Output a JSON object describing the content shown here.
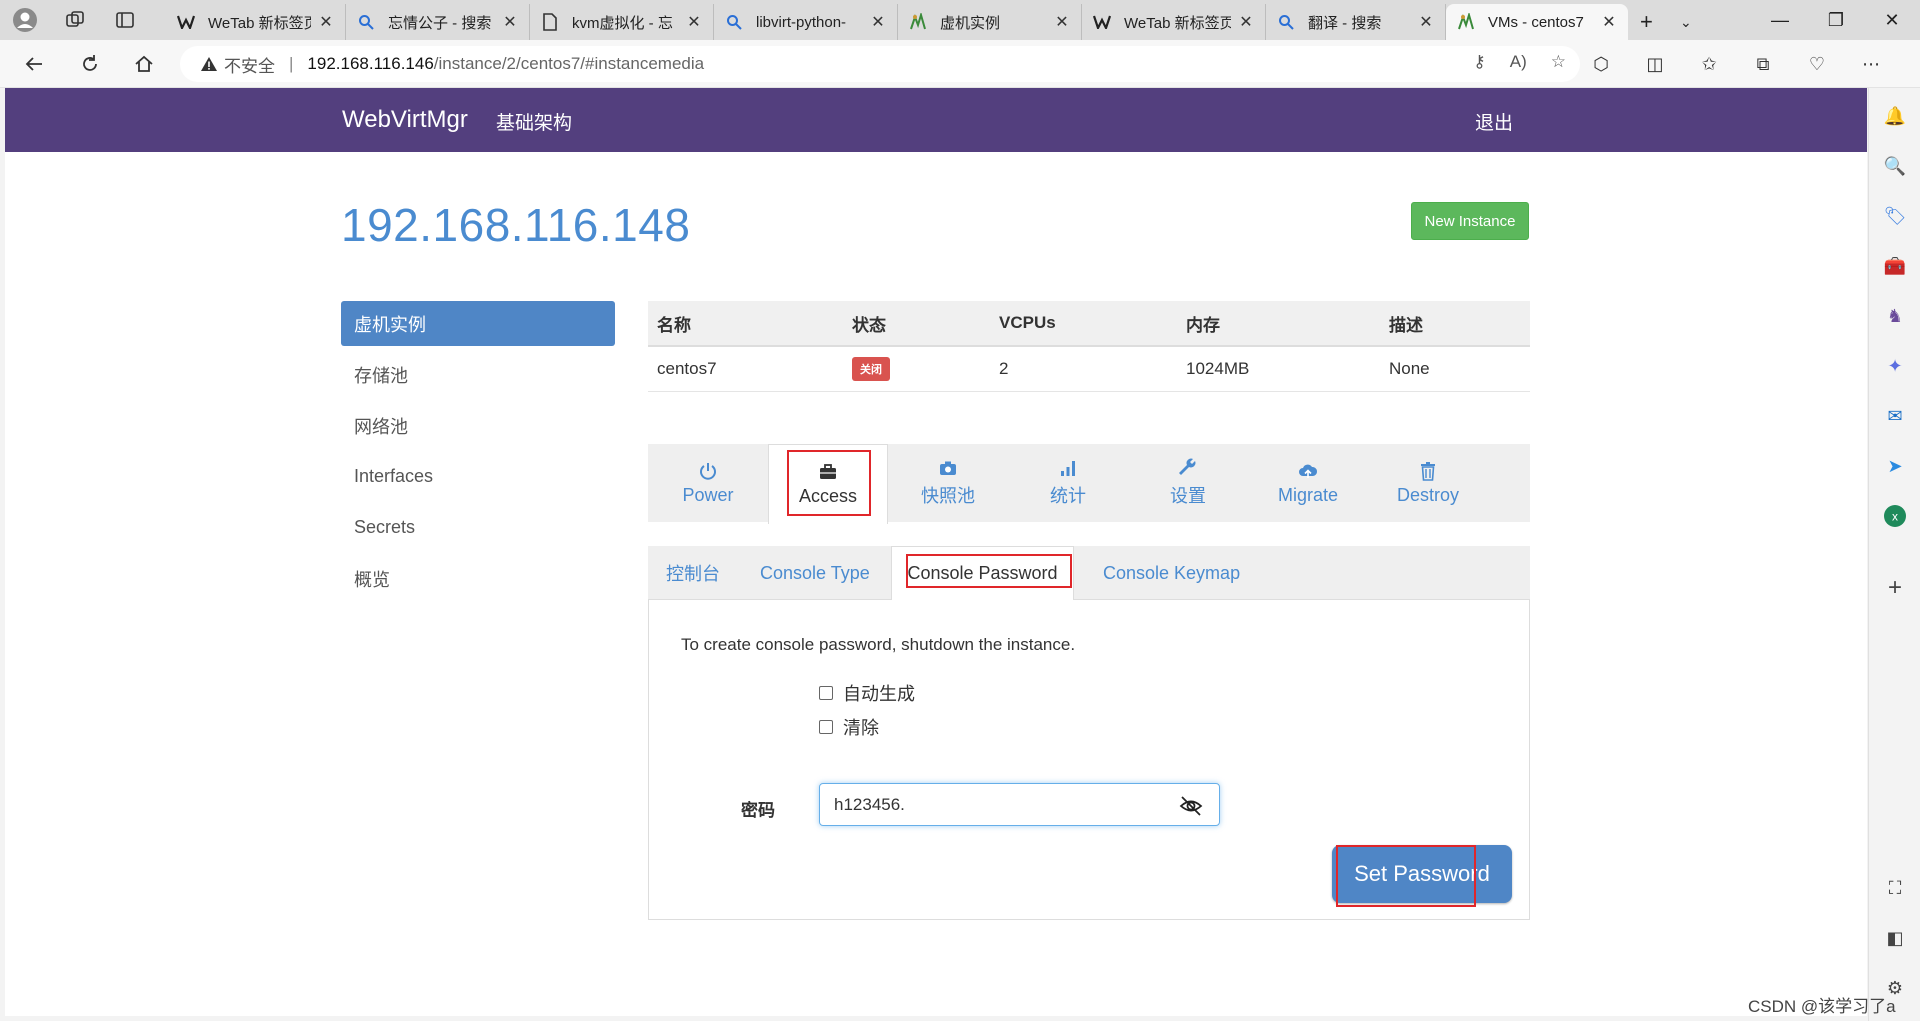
{
  "browser": {
    "tabs": [
      {
        "title": "WeTab 新标签页",
        "icon": "wetab-icon"
      },
      {
        "title": "忘情公子 - 搜索",
        "icon": "search-icon"
      },
      {
        "title": "kvm虚拟化 - 忘",
        "icon": "document-icon"
      },
      {
        "title": "libvirt-python-",
        "icon": "search-icon"
      },
      {
        "title": "虚机实例",
        "icon": "webvirtmgr-icon"
      },
      {
        "title": "WeTab 新标签页",
        "icon": "wetab-icon"
      },
      {
        "title": "翻译 - 搜索",
        "icon": "search-icon"
      },
      {
        "title": "VMs - centos7",
        "icon": "webvirtmgr-icon",
        "active": true
      }
    ],
    "address": {
      "warning": "不安全",
      "separator": "|",
      "host": "192.168.116.146",
      "path": "/instance/2/centos7/#instancemedia"
    }
  },
  "navbar": {
    "brand": "WebVirtMgr",
    "link": "基础架构",
    "logout": "退出"
  },
  "header": {
    "title": "192.168.116.148",
    "new_instance": "New Instance"
  },
  "sidebar": {
    "items": [
      {
        "label": "虚机实例",
        "active": true
      },
      {
        "label": "存储池"
      },
      {
        "label": "网络池"
      },
      {
        "label": "Interfaces"
      },
      {
        "label": "Secrets"
      },
      {
        "label": "概览"
      }
    ]
  },
  "vm_table": {
    "headers": [
      "名称",
      "状态",
      "VCPUs",
      "内存",
      "描述"
    ],
    "row": {
      "name": "centos7",
      "status": "关闭",
      "vcpus": "2",
      "memory": "1024MB",
      "description": "None"
    }
  },
  "action_tabs": [
    {
      "label": "Power",
      "icon": "power-icon"
    },
    {
      "label": "Access",
      "icon": "briefcase-icon",
      "active": true
    },
    {
      "label": "快照池",
      "icon": "camera-icon"
    },
    {
      "label": "统计",
      "icon": "signal-bars-icon"
    },
    {
      "label": "设置",
      "icon": "wrench-icon"
    },
    {
      "label": "Migrate",
      "icon": "cloud-upload-icon"
    },
    {
      "label": "Destroy",
      "icon": "trash-icon"
    }
  ],
  "sub_tabs": [
    {
      "label": "控制台"
    },
    {
      "label": "Console Type"
    },
    {
      "label": "Console Password",
      "active": true
    },
    {
      "label": "Console Keymap"
    }
  ],
  "console_password": {
    "message": "To create console password, shutdown the instance.",
    "auto_generate": "自动生成",
    "clear": "清除",
    "password_label": "密码",
    "password_value": "h123456.",
    "submit": "Set Password"
  },
  "watermark": "CSDN @该学习了a",
  "colors": {
    "navbar": "#533f7e",
    "primary": "#4f86c6",
    "success": "#5cb85c",
    "danger": "#d9534f",
    "highlight_box": "#e0262a"
  }
}
